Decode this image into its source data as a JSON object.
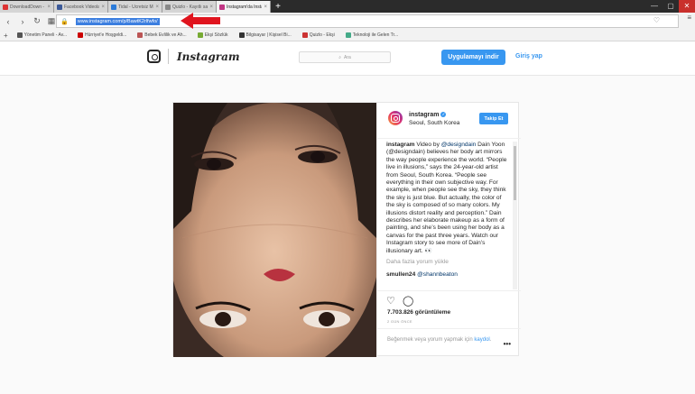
{
  "browser": {
    "tabs": [
      {
        "label": "DownloadDown - Instagram",
        "color": "#d33",
        "active": false
      },
      {
        "label": "Facebook Videolari Nasil...",
        "color": "#3b5998",
        "active": false
      },
      {
        "label": "Tidal - Ücretsiz MP3 indir",
        "color": "#2b7bd9",
        "active": false
      },
      {
        "label": "Quizlo - Kayıtlı sayfa",
        "color": "#888",
        "active": false
      },
      {
        "label": "Instagram'da Instagram",
        "color": "#c13584",
        "active": true
      }
    ],
    "new_tab": "+",
    "window_controls": [
      "—",
      "▢",
      "✕"
    ],
    "url": "www.instagram.com/p/BawtK2rlfwfo/",
    "bookmarks": [
      {
        "label": "Yönetim Paneli - Av...",
        "color": "#555"
      },
      {
        "label": "Hürriyet'e Hoşgeldi...",
        "color": "#c00"
      },
      {
        "label": "Bebek Evlilik ve Ah...",
        "color": "#b55"
      },
      {
        "label": "Ekşi Sözlük",
        "color": "#7a3"
      },
      {
        "label": "Bilgisayar | Kişisel Bi...",
        "color": "#333"
      },
      {
        "label": "Quizlo - Ekşi",
        "color": "#c33"
      },
      {
        "label": "Teknoloji ile Gelen Tr...",
        "color": "#4a8"
      }
    ]
  },
  "instagram": {
    "wordmark": "Instagram",
    "search_placeholder": "Ara",
    "app_button": "Uygulamayı indir",
    "login": "Giriş yap",
    "post": {
      "username": "instagram",
      "location": "Seoul, South Korea",
      "follow": "Takip Et",
      "caption_user": "instagram",
      "caption": "Dain Yoon (@designdain) believes her body art mirrors the way people experience the world. “People live in illusions,” says the 24-year-old artist from Seoul, South Korea. “People see everything in their own subjective way. For example, when people see the sky, they think the sky is just blue. But actually, the color of the sky is composed of so many colors. My illusions distort reality and perception.” Dain describes her elaborate makeup as a form of painting, and she’s been using her body as a canvas for the past three years. Watch our Instagram story to see more of Dain’s illusionary art. 👀",
      "caption_prefix": "Video by ",
      "caption_mention": "@designdain",
      "load_more": "Daha fazla yorum yükle",
      "comment_user": "smullen24",
      "comment_text": "@shannbeaton",
      "views": "7.703.826 görüntüleme",
      "time": "2 GÜN ÖNCE",
      "add_comment_prefix": "Beğenmek veya yorum yapmak için",
      "add_comment_link": "kaydol",
      "add_comment_suffix": ".",
      "more": "•••"
    }
  }
}
